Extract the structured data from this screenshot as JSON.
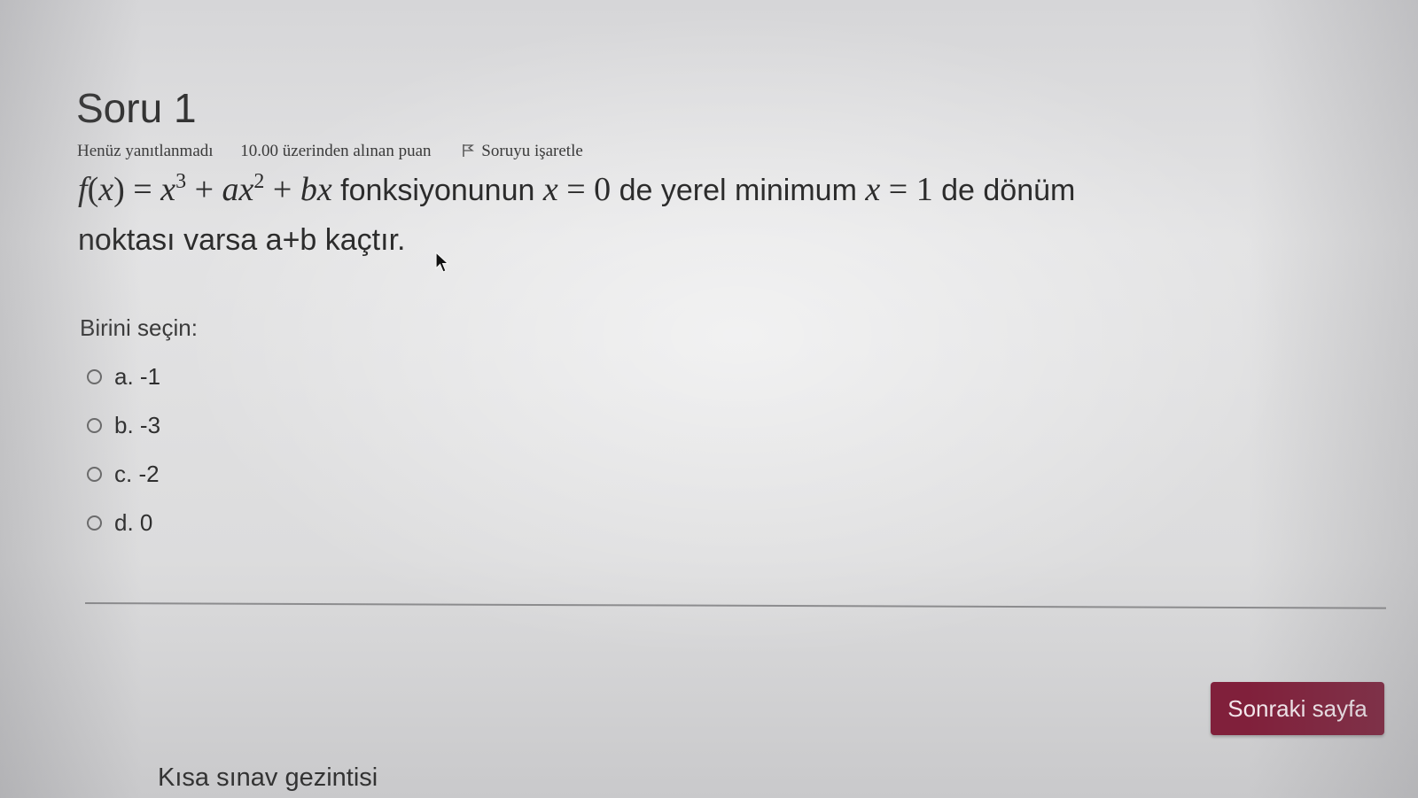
{
  "question": {
    "title": "Soru 1",
    "status": "Henüz yanıtlanmadı",
    "grade_info": "10.00 üzerinden alınan puan",
    "flag_label": "Soruyu işaretle",
    "text": {
      "f": "f",
      "paren_open": "(",
      "x1": "x",
      "paren_close": ")",
      "eq1": " = ",
      "x2": "x",
      "exp3": "3",
      "plus1": " + ",
      "a": "a",
      "x3": "x",
      "exp2": "2",
      "plus2": " + ",
      "b": "b",
      "x4": "x",
      "phrase1": " fonksiyonunun ",
      "x5": "x",
      "eq2": " = ",
      "zero": "0",
      "phrase2": " de yerel minimum ",
      "x6": "x",
      "eq3": " = ",
      "one": "1",
      "phrase3": " de dönüm",
      "line2": "noktası varsa a+b kaçtır."
    }
  },
  "answer": {
    "prompt": "Birini seçin:",
    "options": [
      {
        "label": "a. -1"
      },
      {
        "label": "b. -3"
      },
      {
        "label": "c. -2"
      },
      {
        "label": "d. 0"
      }
    ]
  },
  "navigation": {
    "next_label": "Sonraki sayfa",
    "quiz_nav_title": "Kısa sınav gezintisi"
  },
  "colors": {
    "next_button": "#80203b"
  },
  "icons": {
    "flag": "flag-icon",
    "radio": "radio-unchecked-icon",
    "cursor": "mouse-pointer-icon"
  }
}
